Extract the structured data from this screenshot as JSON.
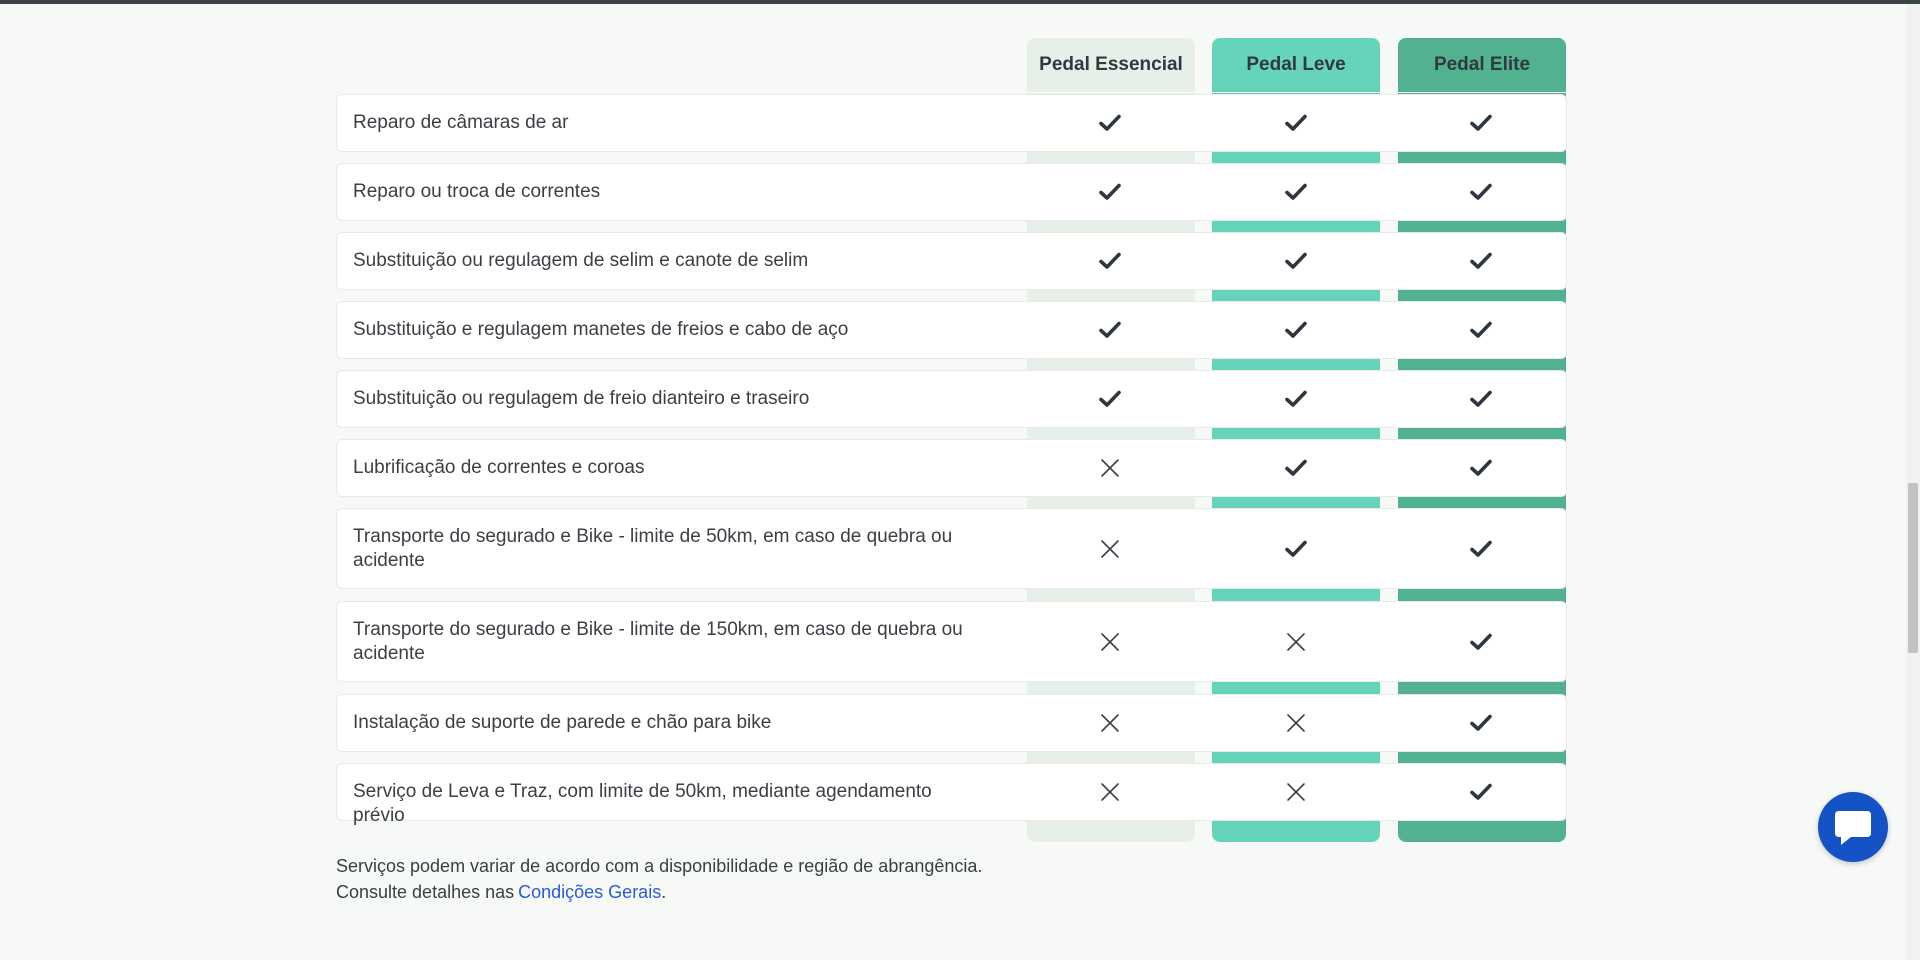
{
  "plans": [
    {
      "name": "Pedal Essencial",
      "color": "#e6f0e8"
    },
    {
      "name": "Pedal Leve",
      "color": "#66d4bb"
    },
    {
      "name": "Pedal Elite",
      "color": "#52b28f"
    }
  ],
  "features": [
    {
      "label": "Reparo de câmaras de ar",
      "included": [
        true,
        true,
        true
      ]
    },
    {
      "label": "Reparo ou troca de correntes",
      "included": [
        true,
        true,
        true
      ]
    },
    {
      "label": "Substituição ou regulagem de selim e canote de selim",
      "included": [
        true,
        true,
        true
      ]
    },
    {
      "label": "Substituição e regulagem manetes de freios e cabo de aço",
      "included": [
        true,
        true,
        true
      ]
    },
    {
      "label": "Substituição ou regulagem de freio dianteiro e traseiro",
      "included": [
        true,
        true,
        true
      ]
    },
    {
      "label": "Lubrificação de correntes e coroas",
      "included": [
        false,
        true,
        true
      ]
    },
    {
      "label": "Transporte do segurado e Bike - limite de 50km, em caso de quebra ou acidente",
      "included": [
        false,
        true,
        true
      ]
    },
    {
      "label": "Transporte do segurado e Bike - limite de 150km, em caso de quebra ou acidente",
      "included": [
        false,
        false,
        true
      ]
    },
    {
      "label": "Instalação de suporte de parede e chão para bike",
      "included": [
        false,
        false,
        true
      ]
    },
    {
      "label": "Serviço de Leva e Traz, com limite de 50km, mediante agendamento prévio",
      "included": [
        false,
        false,
        true
      ]
    }
  ],
  "footnote": {
    "line1": "Serviços podem variar de acordo com a disponibilidade e região de abrangência.",
    "line2_prefix": "Consulte detalhes nas",
    "link_text": "Condições Gerais",
    "line2_suffix": "."
  },
  "icons": {
    "included": "check-icon",
    "not_included": "x-icon",
    "chat": "chat-bubble-icon"
  },
  "colors": {
    "link": "#2a5bd7",
    "chat_button": "#1452c6"
  }
}
